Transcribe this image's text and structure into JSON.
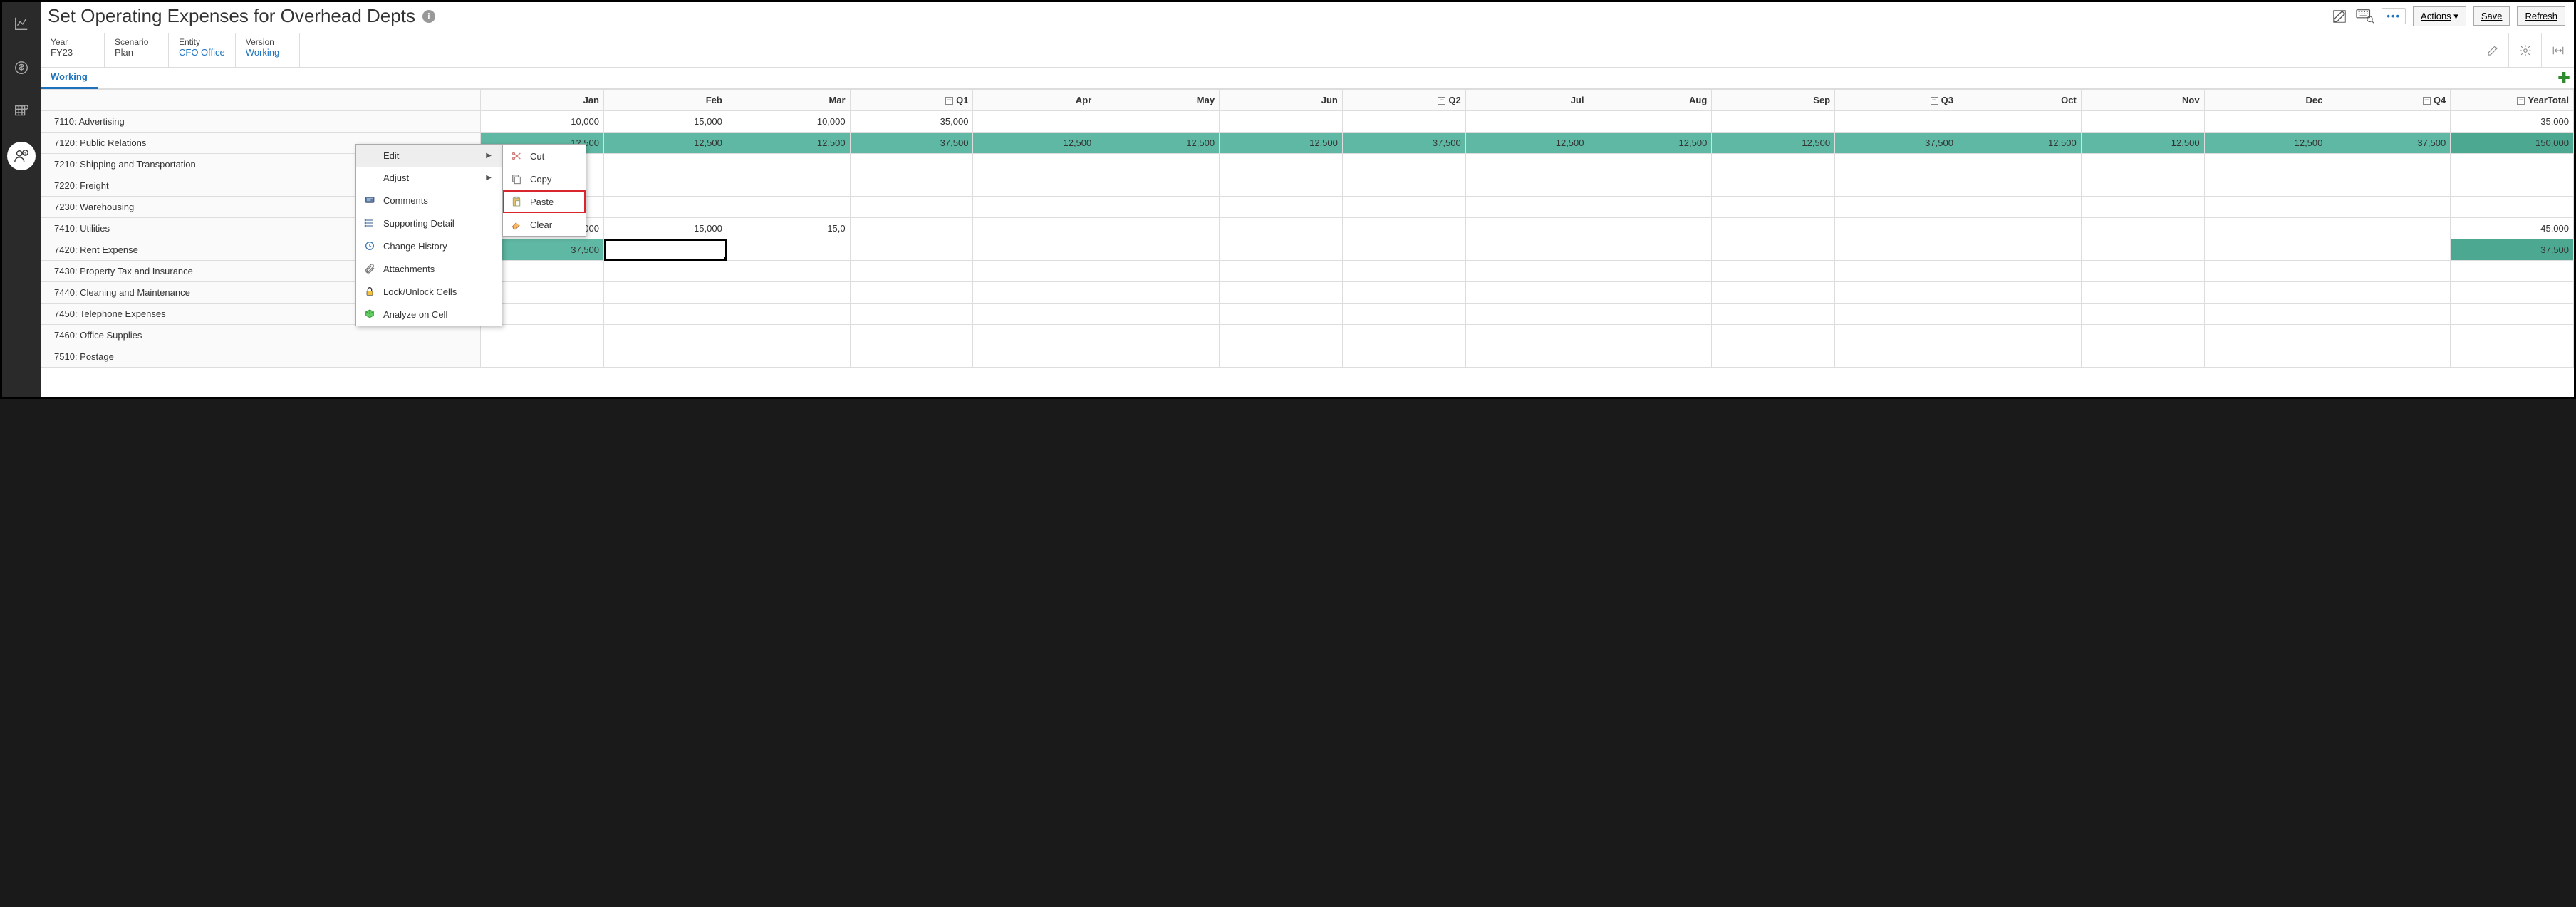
{
  "header": {
    "title": "Set Operating Expenses for Overhead Depts",
    "actions_label": "Actions",
    "save_label": "Save",
    "refresh_label": "Refresh"
  },
  "pov": {
    "year_label": "Year",
    "year_value": "FY23",
    "scenario_label": "Scenario",
    "scenario_value": "Plan",
    "entity_label": "Entity",
    "entity_value": "CFO Office",
    "version_label": "Version",
    "version_value": "Working"
  },
  "tabs": {
    "working": "Working"
  },
  "columns": [
    "Jan",
    "Feb",
    "Mar",
    "Q1",
    "Apr",
    "May",
    "Jun",
    "Q2",
    "Jul",
    "Aug",
    "Sep",
    "Q3",
    "Oct",
    "Nov",
    "Dec",
    "Q4",
    "YearTotal"
  ],
  "rows": [
    {
      "label": "7110: Advertising",
      "cells": [
        "10,000",
        "15,000",
        "10,000",
        "35,000",
        "",
        "",
        "",
        "",
        "",
        "",
        "",
        "",
        "",
        "",
        "",
        "",
        "35,000"
      ],
      "tealCols": []
    },
    {
      "label": "7120: Public Relations",
      "cells": [
        "12,500",
        "12,500",
        "12,500",
        "37,500",
        "12,500",
        "12,500",
        "12,500",
        "37,500",
        "12,500",
        "12,500",
        "12,500",
        "37,500",
        "12,500",
        "12,500",
        "12,500",
        "37,500",
        "150,000"
      ],
      "tealCols": [
        0,
        1,
        2,
        3,
        4,
        5,
        6,
        7,
        8,
        9,
        10,
        11,
        12,
        13,
        14,
        15,
        16
      ]
    },
    {
      "label": "7210: Shipping and Transportation",
      "cells": [
        "",
        "",
        "",
        "",
        "",
        "",
        "",
        "",
        "",
        "",
        "",
        "",
        "",
        "",
        "",
        "",
        ""
      ],
      "tealCols": []
    },
    {
      "label": "7220: Freight",
      "cells": [
        "",
        "",
        "",
        "",
        "",
        "",
        "",
        "",
        "",
        "",
        "",
        "",
        "",
        "",
        "",
        "",
        ""
      ],
      "tealCols": []
    },
    {
      "label": "7230: Warehousing",
      "cells": [
        "",
        "",
        "",
        "",
        "",
        "",
        "",
        "",
        "",
        "",
        "",
        "",
        "",
        "",
        "",
        "",
        ""
      ],
      "tealCols": []
    },
    {
      "label": "7410: Utilities",
      "cells": [
        "15,000",
        "15,000",
        "15,0",
        "",
        "",
        "",
        "",
        "",
        "",
        "",
        "",
        "",
        "",
        "",
        "",
        "",
        "45,000"
      ],
      "tealCols": []
    },
    {
      "label": "7420: Rent Expense",
      "cells": [
        "37,500",
        "",
        "",
        "",
        "",
        "",
        "",
        "",
        "",
        "",
        "",
        "",
        "",
        "",
        "",
        "",
        "37,500"
      ],
      "tealCols": [
        0,
        16
      ],
      "activeCol": 1
    },
    {
      "label": "7430: Property Tax and Insurance",
      "cells": [
        "",
        "",
        "",
        "",
        "",
        "",
        "",
        "",
        "",
        "",
        "",
        "",
        "",
        "",
        "",
        "",
        ""
      ],
      "tealCols": []
    },
    {
      "label": "7440: Cleaning and Maintenance",
      "cells": [
        "",
        "",
        "",
        "",
        "",
        "",
        "",
        "",
        "",
        "",
        "",
        "",
        "",
        "",
        "",
        "",
        ""
      ],
      "tealCols": []
    },
    {
      "label": "7450: Telephone Expenses",
      "cells": [
        "",
        "",
        "",
        "",
        "",
        "",
        "",
        "",
        "",
        "",
        "",
        "",
        "",
        "",
        "",
        "",
        ""
      ],
      "tealCols": []
    },
    {
      "label": "7460: Office Supplies",
      "cells": [
        "",
        "",
        "",
        "",
        "",
        "",
        "",
        "",
        "",
        "",
        "",
        "",
        "",
        "",
        "",
        "",
        ""
      ],
      "tealCols": []
    },
    {
      "label": "7510: Postage",
      "cells": [
        "",
        "",
        "",
        "",
        "",
        "",
        "",
        "",
        "",
        "",
        "",
        "",
        "",
        "",
        "",
        "",
        ""
      ],
      "tealCols": []
    }
  ],
  "quarter_cols": [
    3,
    7,
    11,
    15,
    16
  ],
  "context_menu": {
    "edit": "Edit",
    "adjust": "Adjust",
    "comments": "Comments",
    "supporting_detail": "Supporting Detail",
    "change_history": "Change History",
    "attachments": "Attachments",
    "lock_unlock": "Lock/Unlock Cells",
    "analyze": "Analyze on Cell"
  },
  "edit_submenu": {
    "cut": "Cut",
    "copy": "Copy",
    "paste": "Paste",
    "clear": "Clear"
  }
}
